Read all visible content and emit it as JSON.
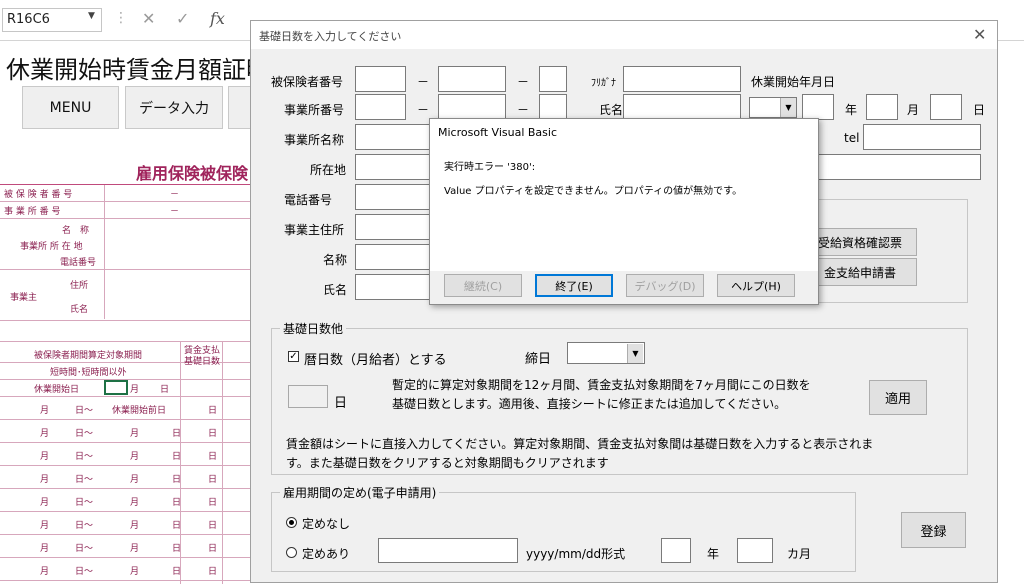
{
  "excel": {
    "name_box": "R16C6",
    "fx_label": "fx",
    "cancel_symbol": "✕",
    "enter_symbol": "✓",
    "sheet_title": "休業開始時賃金月額証明",
    "menu_button": "MENU",
    "data_entry_button": "データ入力",
    "sheet_heading": "雇用保険被保険",
    "grid": {
      "insured_no": "被 保 険 者 番 号",
      "office_no": "事 業 所 番 号",
      "name_label": "名　称",
      "office_addr_label": "事業所 所 在 地",
      "office_phone_label": "電話番号",
      "employer_label": "事業主",
      "employer_addr": "住所",
      "employer_name": "氏名",
      "dash": "－",
      "period_header": "被保険者期間算定対象期間",
      "short_time": "短時間･短時間以外",
      "leave_start_day": "休業開始日",
      "wage_days_header": "賃金支払基礎日数",
      "month": "月",
      "day": "日",
      "day_from": "日～",
      "before_leave": "休業開始前日"
    }
  },
  "userform": {
    "title": "基礎日数を入力してください",
    "close": "✕",
    "labels": {
      "insured_no": "被保険者番号",
      "office_no": "事業所番号",
      "office_name": "事業所名称",
      "address": "所在地",
      "phone": "電話番号",
      "employer_addr": "事業主住所",
      "employer_title": "名称",
      "employer_name": "氏名",
      "furigana": "ﾌﾘｶﾞﾅ",
      "name": "氏名",
      "leave_start": "休業開始年月日",
      "tel": "tel",
      "year": "年",
      "month": "月",
      "day": "日",
      "dash": "－"
    },
    "buttons": {
      "eligibility": "受給資格確認票",
      "wage_application": "金支給申請書",
      "apply": "適用",
      "register": "登録"
    },
    "base_days_frame": {
      "caption": "基礎日数他",
      "calendar_check_label": "暦日数（月給者）とする",
      "calendar_checked": true,
      "closing_day_label": "締日",
      "days_unit": "日",
      "note1": "暫定的に算定対象期間を12ヶ月間、賃金支払対象期間を7ヶ月間にこの日数を",
      "note2": "基礎日数とします。適用後、直接シートに修正または追加してください。",
      "note3": "賃金額はシートに直接入力してください。算定対象期間、賃金支払対象間は基礎日数を入力すると表示されま",
      "note4": "す。また基礎日数をクリアすると対象期間もクリアされます"
    },
    "employment_frame": {
      "caption": "雇用期間の定め(電子申請用)",
      "option_none": "定めなし",
      "option_exists": "定めあり",
      "selected": "定めなし",
      "date_format": "yyyy/mm/dd形式",
      "year": "年",
      "months": "カ月"
    }
  },
  "msgbox": {
    "title": "Microsoft Visual Basic",
    "error_line": "実行時エラー '380':",
    "message": "Value プロパティを設定できません。プロパティの値が無効です。",
    "buttons": {
      "continue": "継続(C)",
      "end": "終了(E)",
      "debug": "デバッグ(D)",
      "help": "ヘルプ(H)"
    }
  }
}
